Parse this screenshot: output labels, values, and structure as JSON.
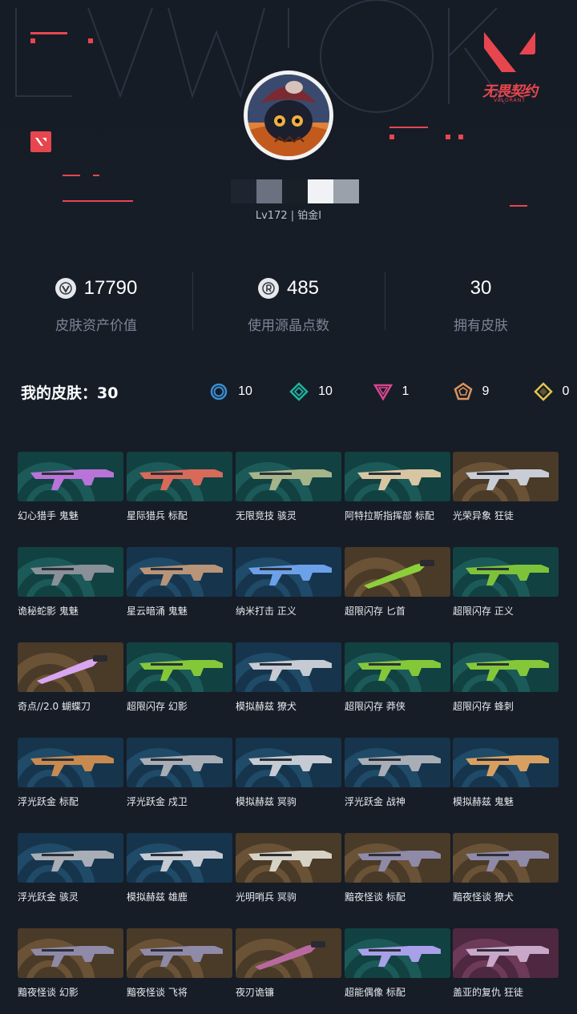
{
  "brand": {
    "name": "无畏契约",
    "sub": "VALORANT"
  },
  "profile": {
    "level": "Lv172 | 铂金I"
  },
  "stats": [
    {
      "icon": "valorant-points-icon",
      "value": "17790",
      "label": "皮肤资产价值"
    },
    {
      "icon": "radianite-icon",
      "value": "485",
      "label": "使用源晶点数"
    },
    {
      "icon": "",
      "value": "30",
      "label": "拥有皮肤"
    }
  ],
  "skins": {
    "title": "我的皮肤：30",
    "tiers": [
      {
        "icon": "select-tier-icon",
        "color": "#3a8fd6",
        "count": "10"
      },
      {
        "icon": "deluxe-tier-icon",
        "color": "#1fb5a0",
        "count": "10"
      },
      {
        "icon": "premium-tier-icon",
        "color": "#d8468e",
        "count": "1"
      },
      {
        "icon": "ultra-tier-icon",
        "color": "#e0935a",
        "count": "9"
      },
      {
        "icon": "exclusive-tier-icon",
        "color": "#e6c44a",
        "count": "0"
      }
    ],
    "items": [
      {
        "name": "幻心猎手 鬼魅",
        "tier": "green",
        "gun": "#b874d8"
      },
      {
        "name": "星际猎兵 标配",
        "tier": "green",
        "gun": "#d86a5a"
      },
      {
        "name": "无限竞技 骇灵",
        "tier": "green",
        "gun": "#a6b48a"
      },
      {
        "name": "阿特拉斯指挥部 标配",
        "tier": "green",
        "gun": "#d8c6a2"
      },
      {
        "name": "光荣异象 狂徒",
        "tier": "gold",
        "gun": "#c8cdd6"
      },
      {
        "name": "诡秘蛇影 鬼魅",
        "tier": "green",
        "gun": "#8a9098"
      },
      {
        "name": "星云暗涌 鬼魅",
        "tier": "blue",
        "gun": "#b89478"
      },
      {
        "name": "纳米打击 正义",
        "tier": "blue",
        "gun": "#6ca0e8"
      },
      {
        "name": "超限闪存 匕首",
        "tier": "gold",
        "gun": "#8ccf3c"
      },
      {
        "name": "超限闪存 正义",
        "tier": "green",
        "gun": "#7ec23a"
      },
      {
        "name": "奇点//2.0 蝴蝶刀",
        "tier": "gold",
        "gun": "#d8a6f0"
      },
      {
        "name": "超限闪存 幻影",
        "tier": "green",
        "gun": "#84c83a"
      },
      {
        "name": "模拟赫兹 獠犬",
        "tier": "blue",
        "gun": "#c6cad2"
      },
      {
        "name": "超限闪存 莽侠",
        "tier": "green",
        "gun": "#84c83a"
      },
      {
        "name": "超限闪存 蜂刺",
        "tier": "green",
        "gun": "#84c83a"
      },
      {
        "name": "浮光跃金 标配",
        "tier": "blue",
        "gun": "#c88a4e"
      },
      {
        "name": "浮光跃金 戍卫",
        "tier": "blue",
        "gun": "#a8adb6"
      },
      {
        "name": "模拟赫兹 冥驹",
        "tier": "blue",
        "gun": "#c6cad2"
      },
      {
        "name": "浮光跃金 战神",
        "tier": "blue",
        "gun": "#a8adb6"
      },
      {
        "name": "模拟赫兹 鬼魅",
        "tier": "blue",
        "gun": "#d8a060"
      },
      {
        "name": "浮光跃金 骇灵",
        "tier": "blue",
        "gun": "#a8adb6"
      },
      {
        "name": "模拟赫兹 雄鹿",
        "tier": "blue",
        "gun": "#c6cad2"
      },
      {
        "name": "光明哨兵 冥驹",
        "tier": "gold",
        "gun": "#d6d2c6"
      },
      {
        "name": "黯夜怪谈 标配",
        "tier": "gold",
        "gun": "#8e8aa8"
      },
      {
        "name": "黯夜怪谈 獠犬",
        "tier": "gold",
        "gun": "#8e8aa8"
      },
      {
        "name": "黯夜怪谈 幻影",
        "tier": "gold",
        "gun": "#8e8aa8"
      },
      {
        "name": "黯夜怪谈 飞将",
        "tier": "gold",
        "gun": "#8e8aa8"
      },
      {
        "name": "夜刃诡镰",
        "tier": "gold",
        "gun": "#b86aa0"
      },
      {
        "name": "超能偶像 标配",
        "tier": "green",
        "gun": "#a8a0e8"
      },
      {
        "name": "盖亚的复仇 狂徒",
        "tier": "pink",
        "gun": "#c8a8c8"
      }
    ]
  }
}
